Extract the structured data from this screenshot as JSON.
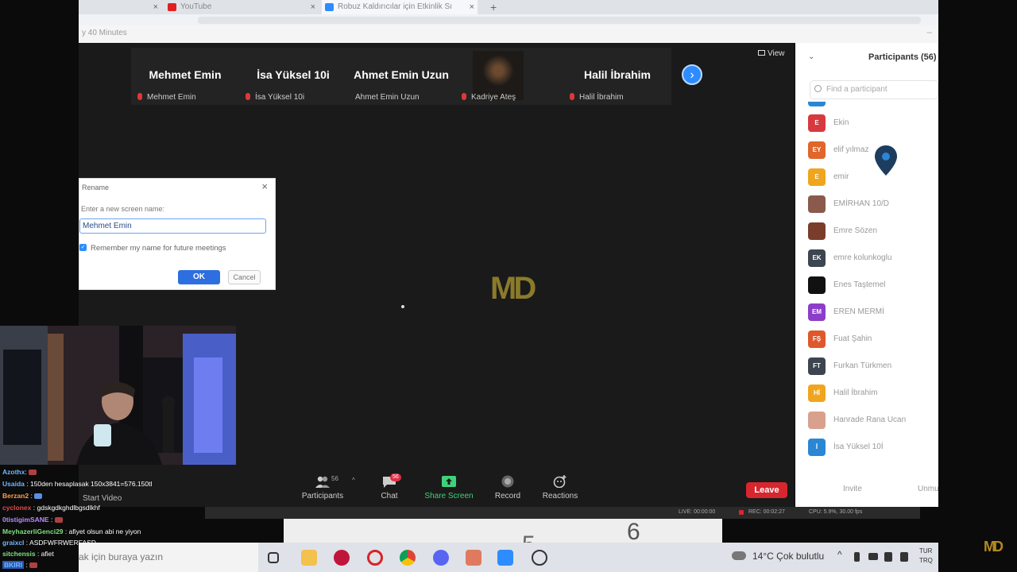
{
  "browser": {
    "tabs": [
      {
        "label": "",
        "close": "×"
      },
      {
        "label": "YouTube",
        "close": "×"
      },
      {
        "label": "Robuz Kaldırıcılar için Etkinlik Sı",
        "close": "×"
      }
    ],
    "new_tab": "+"
  },
  "zoom": {
    "window_title": "y 40 Minutes",
    "view_label": "View",
    "gallery": [
      {
        "name": "Mehmet Emin",
        "label": "Mehmet Emin",
        "muted": true
      },
      {
        "name": "İsa Yüksel 10i",
        "label": "İsa Yüksel 10i",
        "muted": true
      },
      {
        "name": "Ahmet Emin Uzun",
        "label": "Ahmet Emin Uzun",
        "muted": false
      },
      {
        "name": "",
        "label": "Kadriye Ateş",
        "muted": true
      },
      {
        "name": "Halil İbrahim",
        "label": "Halil İbrahim",
        "muted": true
      }
    ],
    "next_arrow": "›",
    "center_logo": "MD",
    "toolbar": {
      "participants_label": "Participants",
      "participants_count": "56",
      "chat_label": "Chat",
      "chat_badge": "56",
      "share_label": "Share Screen",
      "record_label": "Record",
      "reactions_label": "Reactions",
      "leave_label": "Leave",
      "start_video_label": "Start Video"
    },
    "status_bar": {
      "live": "LIVE: 00:00:00",
      "rec": "REC: 00:02:27",
      "cpu": "CPU: 5.9%, 30.00 fps"
    }
  },
  "panel": {
    "title": "Participants (56)",
    "search_placeholder": "Find a participant",
    "participants": [
      {
        "initials": "E",
        "name": "Ekin",
        "color": "#d8393f"
      },
      {
        "initials": "EY",
        "name": "elif yılmaz",
        "color": "#e0662c"
      },
      {
        "initials": "E",
        "name": "emir",
        "color": "#f0a51f"
      },
      {
        "initials": "",
        "name": "EMİRHAN 10/D",
        "color": "#8a5a4c"
      },
      {
        "initials": "",
        "name": "Emre Sözen",
        "color": "#7a3d2c"
      },
      {
        "initials": "EK",
        "name": "emre kolunkoglu",
        "color": "#3d4550"
      },
      {
        "initials": "",
        "name": "Enes Taştemel",
        "color": "#111111"
      },
      {
        "initials": "EM",
        "name": "EREN MERMİ",
        "color": "#8c3ec9"
      },
      {
        "initials": "FŞ",
        "name": "Fuat Şahin",
        "color": "#e0572c"
      },
      {
        "initials": "FT",
        "name": "Furkan Türkmen",
        "color": "#3d4550"
      },
      {
        "initials": "Hİ",
        "name": "Halil İbrahim",
        "color": "#f0a51f"
      },
      {
        "initials": "",
        "name": "Hanrade Rana Ucan",
        "color": "#d9a08e"
      },
      {
        "initials": "İ",
        "name": "İsa Yüksel 10İ",
        "color": "#2b86d4"
      }
    ],
    "invite_label": "Invite",
    "unmute_label": "Unmu"
  },
  "rename_dialog": {
    "title": "Rename",
    "close": "×",
    "prompt": "Enter a new screen name:",
    "value": "Mehmet Emin",
    "remember_label": "Remember my name for future meetings",
    "ok_label": "OK",
    "cancel_label": "Cancel"
  },
  "page_below": {
    "digit": "6",
    "digit2": "5"
  },
  "chat": [
    {
      "user": "Azothx",
      "user_color": "#6fb6ff",
      "text": "",
      "emote": true
    },
    {
      "user": "Usaida",
      "user_color": "#6fb6ff",
      "text": "150den hesaplasak 150x3841=576.150tl",
      "emote": false
    },
    {
      "user": "Berzan2",
      "user_color": "#ff9d4a",
      "text": "",
      "emote": true
    },
    {
      "user": "cyclonex",
      "user_color": "#e04a4a",
      "text": "gdskgdkghdlbgsdlkhf",
      "emote": false
    },
    {
      "user": "0tistigimSANE",
      "user_color": "#b98cff",
      "text": "",
      "emote": true
    },
    {
      "user": "MeyhazerliGenci29",
      "user_color": "#7ee07e",
      "text": "afiyet olsun abi ne yiyon",
      "emote": false
    },
    {
      "user": "graixcl",
      "user_color": "#6fb6ff",
      "text": "ASDFWFRWERFASD",
      "emote": false
    },
    {
      "user": "sitchensis",
      "user_color": "#7ee07e",
      "text": "afiet",
      "emote": false
    },
    {
      "user": "BKIRI",
      "user_color": "#6fb6ff",
      "text": "",
      "emote": true
    }
  ],
  "taskbar": {
    "search_placeholder": "ak için buraya yazın",
    "weather": "14°C  Çok bulutlu",
    "lang_top": "TUR",
    "lang_bottom": "TRQ"
  },
  "corner_logo": "MD",
  "colors": {
    "zoom_blue": "#2d8cff",
    "leave_red": "#d8262f",
    "share_green": "#3fd17c"
  }
}
